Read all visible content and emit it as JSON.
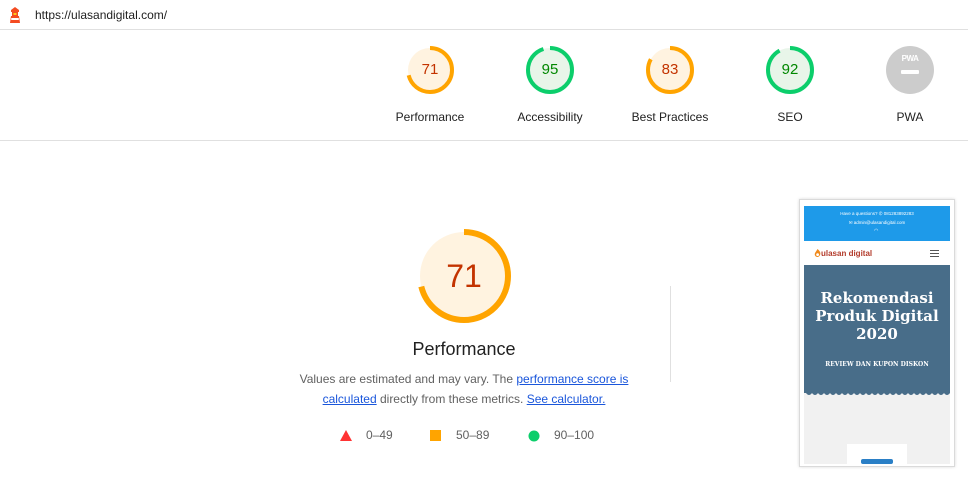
{
  "url": "https://ulasandigital.com/",
  "gauges": [
    {
      "score": "71",
      "label": "Performance",
      "fraction": 0.71,
      "color": "#ffa400",
      "fill": "#fff3e0",
      "text_color": "#c33300"
    },
    {
      "score": "95",
      "label": "Accessibility",
      "fraction": 0.95,
      "color": "#0cce6b",
      "fill": "#e8f5e9",
      "text_color": "#008800"
    },
    {
      "score": "83",
      "label": "Best Practices",
      "fraction": 0.83,
      "color": "#ffa400",
      "fill": "#fff3e0",
      "text_color": "#c33300"
    },
    {
      "score": "92",
      "label": "SEO",
      "fraction": 0.92,
      "color": "#0cce6b",
      "fill": "#e8f5e9",
      "text_color": "#008800"
    }
  ],
  "pwa": {
    "badge_text": "PWA",
    "label": "PWA",
    "color": "#cccccc"
  },
  "main": {
    "score": "71",
    "fraction": 0.71,
    "title": "Performance",
    "desc_prefix": "Values are estimated and may vary. The ",
    "desc_link1": "performance score is calculated",
    "desc_middle": " directly from these metrics. ",
    "desc_link2": "See calculator."
  },
  "legend": [
    {
      "range": "0–49",
      "shape": "triangle-icon",
      "color": "#ff3333"
    },
    {
      "range": "50–89",
      "shape": "square-icon",
      "color": "#ffa400"
    },
    {
      "range": "90–100",
      "shape": "circle-icon",
      "color": "#0cce6b"
    }
  ],
  "screenshot": {
    "topbar_line1": "Have a questions?   ✆ 081283892283",
    "topbar_line2": "✉ admin@ulasandigital.com",
    "logo_text": "ulasan digital",
    "hero_title": "Rekomendasi Produk Digital 2020",
    "hero_subtitle": "REVIEW DAN KUPON DISKON"
  }
}
